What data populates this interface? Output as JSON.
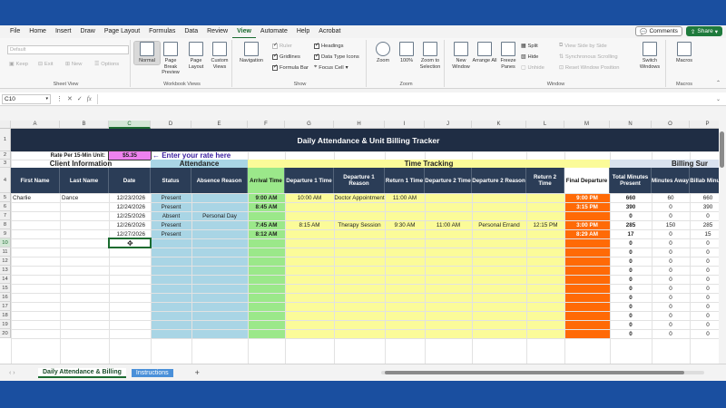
{
  "menu": [
    "File",
    "Home",
    "Insert",
    "Draw",
    "Page Layout",
    "Formulas",
    "Data",
    "Review",
    "View",
    "Automate",
    "Help",
    "Acrobat"
  ],
  "active_menu": "View",
  "top_right": {
    "comments": "Comments",
    "share": "Share"
  },
  "ribbon": {
    "sheet_view": {
      "select": "Default",
      "keep": "Keep",
      "exit": "Exit",
      "new": "New",
      "options": "Options",
      "label": "Sheet View"
    },
    "workbook_views": {
      "normal": "Normal",
      "page_break": "Page Break Preview",
      "page_layout": "Page Layout",
      "custom": "Custom Views",
      "label": "Workbook Views"
    },
    "show": {
      "navigation": "Navigation",
      "ruler": "Ruler",
      "gridlines": "Gridlines",
      "formula_bar": "Formula Bar",
      "headings": "Headings",
      "data_type_icons": "Data Type Icons",
      "focus_cell": "Focus Cell",
      "label": "Show"
    },
    "zoom": {
      "zoom": "Zoom",
      "hundred": "100%",
      "to_selection": "Zoom to Selection",
      "label": "Zoom"
    },
    "window": {
      "new_window": "New Window",
      "arrange_all": "Arrange All",
      "freeze_panes": "Freeze Panes",
      "split": "Split",
      "hide": "Hide",
      "unhide": "Unhide",
      "side_by_side": "View Side by Side",
      "sync_scrolling": "Synchronous Scrolling",
      "reset_position": "Reset Window Position",
      "switch_windows": "Switch Windows",
      "label": "Window"
    },
    "macros": {
      "macros": "Macros",
      "label": "Macros"
    }
  },
  "formula_bar": {
    "name_box": "C10",
    "fx": "fx",
    "value": ""
  },
  "columns": [
    "A",
    "B",
    "C",
    "D",
    "E",
    "F",
    "G",
    "H",
    "I",
    "J",
    "K",
    "L",
    "M",
    "N",
    "O",
    "P"
  ],
  "selected_column": "C",
  "selected_row": "10",
  "rows": [
    "1",
    "2",
    "3",
    "4",
    "5",
    "6",
    "7",
    "8",
    "9",
    "10",
    "11",
    "12",
    "13",
    "14",
    "15",
    "16",
    "17",
    "18",
    "19",
    "20"
  ],
  "sheet": {
    "title": "Daily Attendance & Unit Billing Tracker",
    "rate_label": "Rate Per 15-Min Unit:",
    "rate_value": "$5.35",
    "rate_hint": "← Enter your rate here",
    "sections": {
      "client": "Client Information",
      "attendance": "Attendance",
      "time": "Time Tracking",
      "billing": "Billing Sur"
    },
    "headers": [
      "First Name",
      "Last Name",
      "Date",
      "Status",
      "Absence Reason",
      "Arrival Time",
      "Departure 1 Time",
      "Departure 1 Reason",
      "Return 1 Time",
      "Departure 2 Time",
      "Departure 2 Reason",
      "Return 2 Time",
      "Final Departure",
      "Total Minutes Present",
      "Minutes Away",
      "Billab Minute"
    ],
    "data_rows": [
      [
        "Charlie",
        "Dance",
        "12/23/2026",
        "Present",
        "",
        "9:00 AM",
        "10:00 AM",
        "Doctor Appointment",
        "11:00 AM",
        "",
        "",
        "",
        "9:00 PM",
        "660",
        "60",
        "660"
      ],
      [
        "",
        "",
        "12/24/2026",
        "Present",
        "",
        "8:45 AM",
        "",
        "",
        "",
        "",
        "",
        "",
        "3:15 PM",
        "390",
        "0",
        "390"
      ],
      [
        "",
        "",
        "12/25/2026",
        "Absent",
        "Personal Day",
        "",
        "",
        "",
        "",
        "",
        "",
        "",
        "",
        "0",
        "0",
        "0"
      ],
      [
        "",
        "",
        "12/26/2026",
        "Present",
        "",
        "7:45 AM",
        "8:15 AM",
        "Therapy Session",
        "9:30 AM",
        "11:00 AM",
        "Personal Errand",
        "12:15 PM",
        "3:00 PM",
        "285",
        "150",
        "285"
      ],
      [
        "",
        "",
        "12/27/2026",
        "Present",
        "",
        "8:12 AM",
        "",
        "",
        "",
        "",
        "",
        "",
        "8:29 AM",
        "17",
        "0",
        "15"
      ]
    ],
    "empty_row_values": [
      "0",
      "0",
      "0"
    ]
  },
  "tabs": {
    "active": "Daily Attendance & Billing",
    "other": "Instructions",
    "add": "+"
  },
  "colors": {
    "title_bg": "#1f2d44",
    "header_bg": "#2b3d57",
    "attendance_bg": "#a9d5e5",
    "arrival_bg": "#9be88a",
    "time_bg": "#fbfb99",
    "final_bg": "#ff6a06",
    "billing_bg": "#d9e2ef",
    "rate_bg": "#ee82ee",
    "accent": "#1a6b2f"
  }
}
